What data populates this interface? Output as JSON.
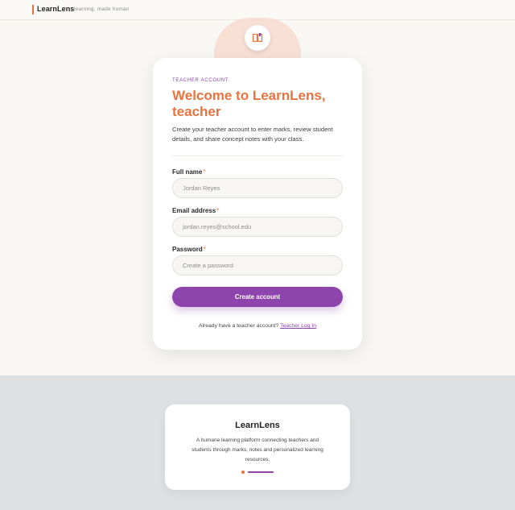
{
  "header": {
    "brand_name": "LearnLens",
    "tagline": "learning, made human"
  },
  "signup": {
    "eyebrow": "TEACHER ACCOUNT",
    "title": "Welcome to LearnLens, teacher",
    "subtitle": "Create your teacher account to enter marks, review student details, and share concept notes with your class.",
    "fields": [
      {
        "label": "Full name",
        "required": "*",
        "placeholder": "Jordan Reyes",
        "value": ""
      },
      {
        "label": "Email address",
        "required": "*",
        "placeholder": "jordan.reyes@school.edu",
        "value": ""
      },
      {
        "label": "Password",
        "required": "*",
        "placeholder": "Create a password",
        "value": ""
      }
    ],
    "submit_label": "Create account",
    "login_prompt": "Already have a teacher account?",
    "login_link": "Teacher Log In"
  },
  "footer": {
    "name": "LearnLens",
    "description": "A humane learning platform connecting teachers and students through marks, notes and personalized learning resources."
  },
  "colors": {
    "accent_orange": "#e8733f",
    "accent_purple": "#8e44ad",
    "page_bg": "#f9f7f3",
    "footer_bg": "#dde1e4"
  },
  "icons": {
    "badge": "book-open-icon"
  }
}
